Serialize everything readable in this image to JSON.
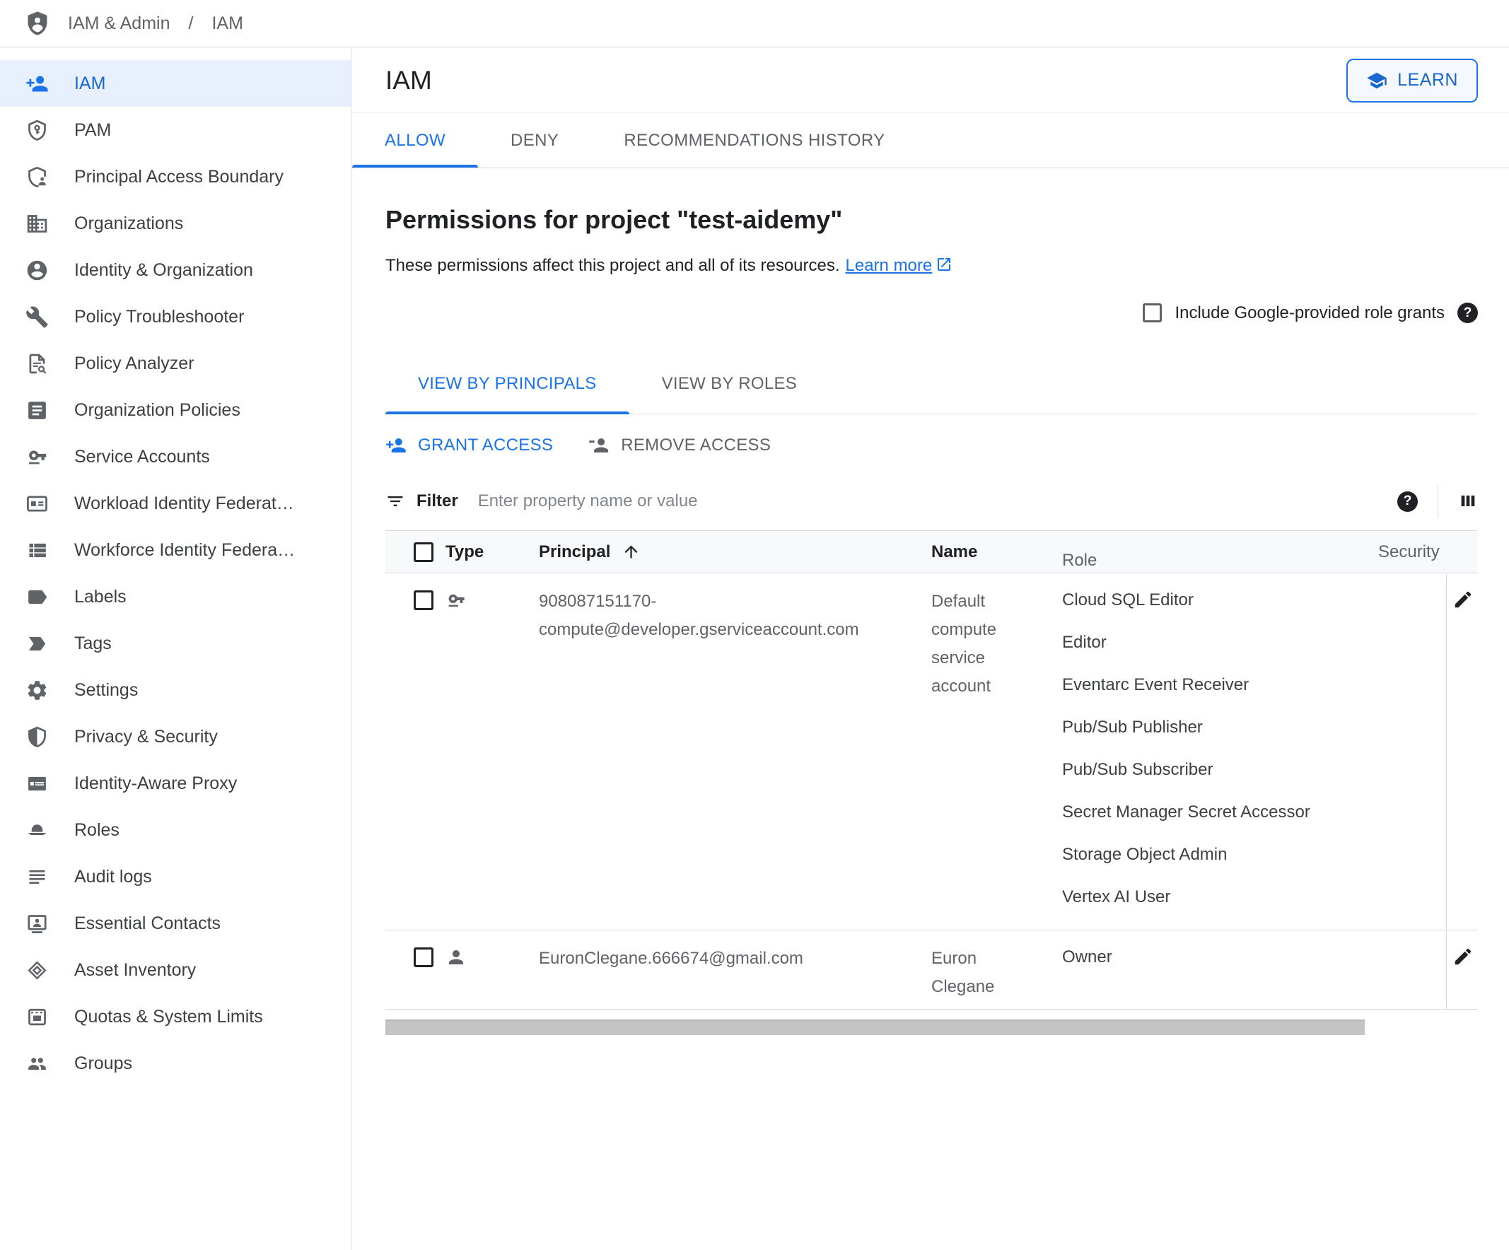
{
  "colors": {
    "accent": "#1a73e8",
    "accent_dark": "#1967d2",
    "selected_bg": "#e8f0fe",
    "border": "#dadce0",
    "text": "#202124",
    "muted": "#5f6368",
    "table_header_bg": "#f8f9fa",
    "scrollbar": "#c4c4c4"
  },
  "header": {
    "app": "IAM & Admin",
    "separator": "/",
    "page": "IAM",
    "logo_icon": "iam-admin-logo"
  },
  "sidebar": {
    "items": [
      {
        "label": "IAM",
        "icon": "person-add",
        "active": true
      },
      {
        "label": "PAM",
        "icon": "shield-key",
        "active": false
      },
      {
        "label": "Principal Access Boundary",
        "icon": "shield-person",
        "active": false
      },
      {
        "label": "Organizations",
        "icon": "domain",
        "active": false
      },
      {
        "label": "Identity & Organization",
        "icon": "account-circle",
        "active": false
      },
      {
        "label": "Policy Troubleshooter",
        "icon": "wrench",
        "active": false
      },
      {
        "label": "Policy Analyzer",
        "icon": "doc-search",
        "active": false
      },
      {
        "label": "Organization Policies",
        "icon": "article",
        "active": false
      },
      {
        "label": "Service Accounts",
        "icon": "key-badge",
        "active": false
      },
      {
        "label": "Workload Identity Federat…",
        "icon": "card",
        "active": false
      },
      {
        "label": "Workforce Identity Federa…",
        "icon": "list",
        "active": false
      },
      {
        "label": "Labels",
        "icon": "label",
        "active": false
      },
      {
        "label": "Tags",
        "icon": "label-important",
        "active": false
      },
      {
        "label": "Settings",
        "icon": "gear",
        "active": false
      },
      {
        "label": "Privacy & Security",
        "icon": "shield-half",
        "active": false
      },
      {
        "label": "Identity-Aware Proxy",
        "icon": "iap",
        "active": false
      },
      {
        "label": "Roles",
        "icon": "hat",
        "active": false
      },
      {
        "label": "Audit logs",
        "icon": "subject",
        "active": false
      },
      {
        "label": "Essential Contacts",
        "icon": "contact",
        "active": false
      },
      {
        "label": "Asset Inventory",
        "icon": "diamonds",
        "active": false
      },
      {
        "label": "Quotas & System Limits",
        "icon": "quota",
        "active": false
      },
      {
        "label": "Groups",
        "icon": "groups",
        "active": false
      }
    ]
  },
  "main": {
    "title": "IAM",
    "learn_label": "LEARN",
    "tabs": [
      {
        "label": "ALLOW",
        "active": true
      },
      {
        "label": "DENY",
        "active": false
      },
      {
        "label": "RECOMMENDATIONS HISTORY",
        "active": false
      }
    ],
    "heading": "Permissions for project \"test-aidemy\"",
    "description": "These permissions affect this project and all of its resources.",
    "learn_more": "Learn more",
    "include_label": "Include Google-provided role grants",
    "view_tabs": [
      {
        "label": "VIEW BY PRINCIPALS",
        "active": true
      },
      {
        "label": "VIEW BY ROLES",
        "active": false
      }
    ],
    "actions": {
      "grant": "GRANT ACCESS",
      "remove": "REMOVE ACCESS"
    },
    "filter": {
      "label": "Filter",
      "placeholder": "Enter property name or value"
    },
    "table": {
      "columns": [
        {
          "label": "Type",
          "muted": false,
          "sorted": false
        },
        {
          "label": "Principal",
          "muted": false,
          "sorted": true
        },
        {
          "label": "Name",
          "muted": false,
          "sorted": false
        },
        {
          "label": "Role",
          "muted": true,
          "sorted": false
        },
        {
          "label": "Security",
          "muted": true,
          "sorted": false
        }
      ],
      "rows": [
        {
          "type": "service-account",
          "principal": "908087151170-compute@developer.gserviceaccount.com",
          "name": "Default compute service account",
          "roles": [
            "Cloud SQL Editor",
            "Editor",
            "Eventarc Event Receiver",
            "Pub/Sub Publisher",
            "Pub/Sub Subscriber",
            "Secret Manager Secret Accessor",
            "Storage Object Admin",
            "Vertex AI User"
          ]
        },
        {
          "type": "user",
          "principal": "EuronClegane.666674@gmail.com",
          "name": "Euron Clegane",
          "roles": [
            "Owner"
          ]
        }
      ]
    }
  }
}
